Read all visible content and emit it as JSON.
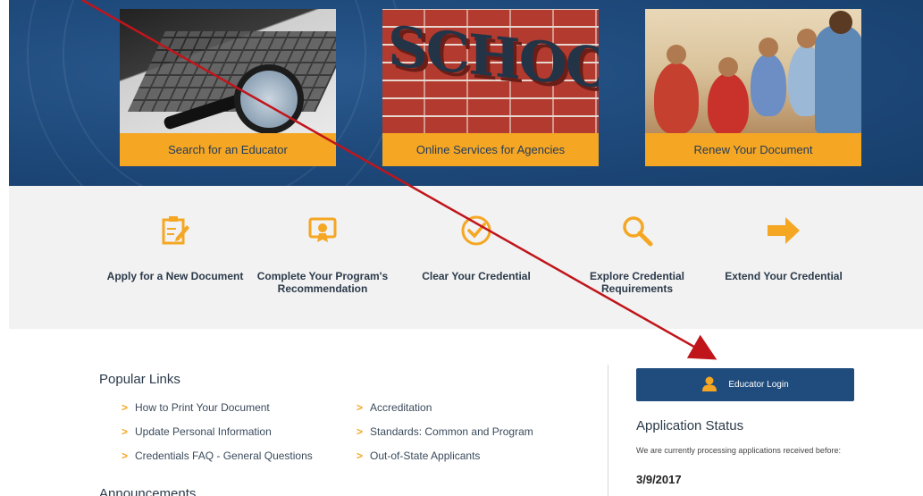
{
  "tiles": [
    {
      "label": "Search for an Educator"
    },
    {
      "label": "Online Services for Agencies",
      "photo_text": "SCHOOL"
    },
    {
      "label": "Renew Your Document"
    }
  ],
  "quick_links": [
    {
      "label": "Apply for a New Document",
      "icon": "edit-document-icon"
    },
    {
      "label": "Complete Your Program's Recommendation",
      "icon": "certificate-icon"
    },
    {
      "label": "Clear Your Credential",
      "icon": "check-circle-icon"
    },
    {
      "label": "Explore Credential Requirements",
      "icon": "magnifier-icon"
    },
    {
      "label": "Extend Your Credential",
      "icon": "arrow-right-icon"
    }
  ],
  "popular_links": {
    "title": "Popular Links",
    "left": [
      "How to Print Your Document",
      "Update Personal Information",
      "Credentials FAQ - General Questions"
    ],
    "right": [
      "Accreditation",
      "Standards: Common and Program",
      "Out-of-State Applicants"
    ]
  },
  "announcements": {
    "title": "Announcements"
  },
  "login": {
    "label": "Educator Login",
    "icon": "user-icon"
  },
  "application_status": {
    "title": "Application Status",
    "text": "We are currently processing applications received before:",
    "date": "3/9/2017"
  },
  "colors": {
    "navy": "#1f4b7d",
    "accent": "#f5a623",
    "annotation": "#c0151b"
  }
}
